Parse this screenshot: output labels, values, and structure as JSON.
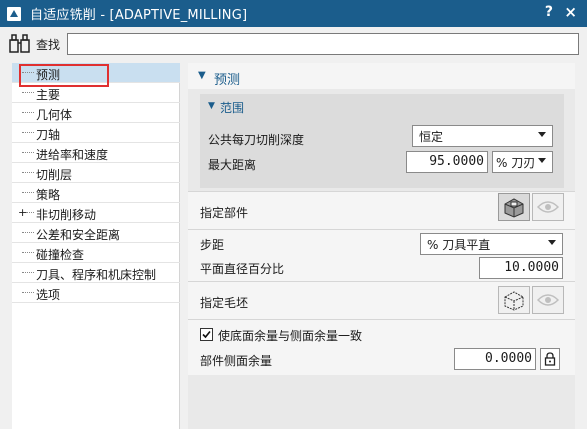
{
  "window": {
    "title": "自适应铣削 - [ADAPTIVE_MILLING]",
    "help_label": "?",
    "close_label": "×"
  },
  "find": {
    "label": "查找",
    "value": ""
  },
  "tree": {
    "items": [
      {
        "label": "预测",
        "selected": true
      },
      {
        "label": "主要"
      },
      {
        "label": "几何体"
      },
      {
        "label": "刀轴"
      },
      {
        "label": "进给率和速度"
      },
      {
        "label": "切削层"
      },
      {
        "label": "策略"
      },
      {
        "label": "非切削移动",
        "expander": "+"
      },
      {
        "label": "公差和安全距离"
      },
      {
        "label": "碰撞检查"
      },
      {
        "label": "刀具、程序和机床控制"
      },
      {
        "label": "选项"
      }
    ]
  },
  "panel": {
    "group_title": "预测",
    "range": {
      "title": "范围",
      "depth_label": "公共每刀切削深度",
      "depth_value": "恒定",
      "max_dist_label": "最大距离",
      "max_dist_value": "95.0000",
      "max_dist_unit": "% 刀刃"
    },
    "part": {
      "label": "指定部件"
    },
    "stepover": {
      "label": "步距",
      "value": "% 刀具平直",
      "percent_label": "平面直径百分比",
      "percent_value": "10.0000"
    },
    "blank": {
      "label": "指定毛坯"
    },
    "stock": {
      "checkbox_label": "使底面余量与侧面余量一致",
      "checked": true,
      "side_label": "部件侧面余量",
      "side_value": "0.0000"
    }
  },
  "colors": {
    "title_bar": "#1b5d8c",
    "accent": "#1b5d8c",
    "selection": "#c9dff0",
    "highlight_box": "#e03030"
  }
}
